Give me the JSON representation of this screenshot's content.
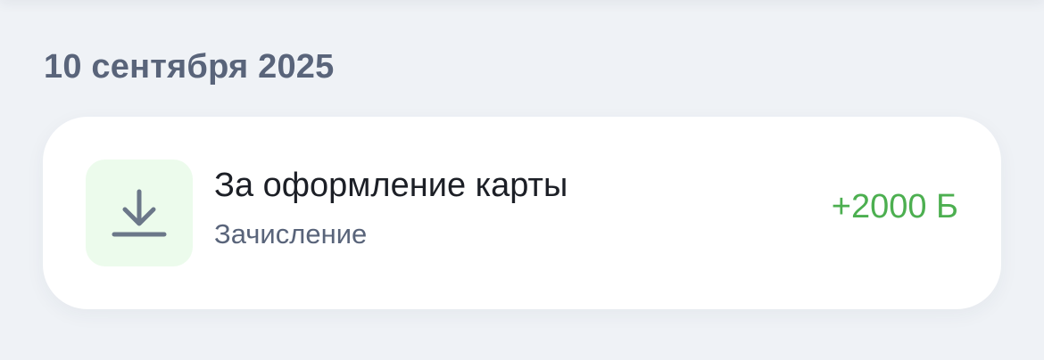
{
  "date_group": {
    "date_label": "10 сентября 2025"
  },
  "transaction": {
    "icon": "download-arrow-icon",
    "title": "За оформление карты",
    "type_label": "Зачисление",
    "amount": "+2000 Б",
    "colors": {
      "amount": "#4caf50",
      "icon_background": "#ecfbec",
      "icon": "#6b7789"
    }
  }
}
